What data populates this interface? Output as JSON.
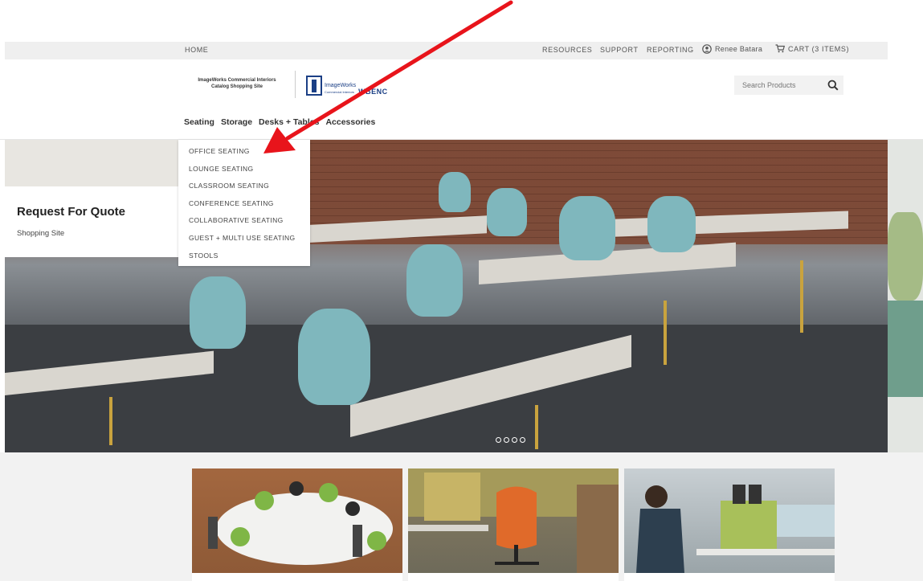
{
  "topbar": {
    "home": "HOME",
    "resources": "RESOURCES",
    "support": "SUPPORT",
    "reporting": "REPORTING",
    "user_name": "Renee Batara",
    "cart": "CART (3 ITEMS)"
  },
  "header": {
    "logo_line1": "ImageWorks Commercial Interiors",
    "logo_line2": "Catalog Shopping Site",
    "logo2_brand": "ImageWorks",
    "logo2_sub": "Commercial Interiors",
    "logo2_suffix": "WBENC"
  },
  "search": {
    "placeholder": "Search Products"
  },
  "nav": {
    "items": [
      "Seating",
      "Storage",
      "Desks + Tables",
      "Accessories"
    ]
  },
  "dropdown": {
    "items": [
      "OFFICE SEATING",
      "LOUNGE SEATING",
      "CLASSROOM SEATING",
      "CONFERENCE SEATING",
      "COLLABORATIVE SEATING",
      "GUEST + MULTI USE SEATING",
      "STOOLS"
    ]
  },
  "hero": {
    "title": "Request For Quote",
    "subtitle": "Shopping Site",
    "slide_count": 4
  },
  "colors": {
    "annotation_arrow": "#e8141b",
    "brand_blue": "#1b3f85"
  },
  "icons": {
    "user": "user-circle-icon",
    "cart": "cart-icon",
    "search": "search-icon"
  }
}
